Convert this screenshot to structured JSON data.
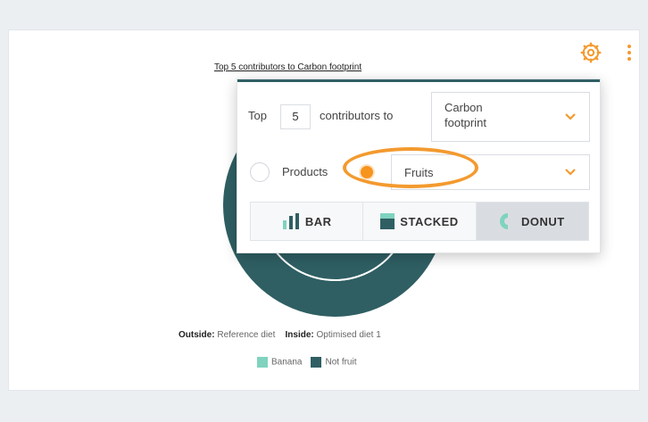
{
  "chart_card": {
    "title": "Top 5 contributors to Carbon footprint",
    "legend": {
      "outside_label": "Outside:",
      "outside_value": "Reference diet",
      "inside_label": "Inside:",
      "inside_value": "Optimised diet 1",
      "items": [
        {
          "label": "Banana",
          "color": "#7fd3bf"
        },
        {
          "label": "Not fruit",
          "color": "#2f5f63"
        }
      ]
    }
  },
  "chart_data": {
    "type": "pie",
    "title": "Top 5 contributors to Carbon footprint",
    "series": [
      {
        "name": "Reference diet",
        "ring": "outside",
        "categories": [
          "Banana",
          "Not fruit"
        ],
        "values": [
          0,
          100
        ]
      },
      {
        "name": "Optimised diet 1",
        "ring": "inside",
        "categories": [
          "Banana",
          "Not fruit"
        ],
        "values": [
          0,
          100
        ]
      }
    ],
    "legend_position": "bottom"
  },
  "settings_panel": {
    "top_label": "Top",
    "top_count": "5",
    "contributors_label": "contributors to",
    "metric_select": {
      "value": "Carbon\nfootprint"
    },
    "products_label": "Products",
    "category_select": {
      "value": "Fruits"
    },
    "chart_types": [
      {
        "label": "BAR",
        "active": false
      },
      {
        "label": "STACKED",
        "active": false
      },
      {
        "label": "DONUT",
        "active": true
      }
    ]
  },
  "icons": {
    "settings": "gear-icon",
    "more": "kebab-menu-icon",
    "chevron": "chevron-down-icon"
  },
  "colors": {
    "accent_orange": "#f39a2f",
    "dark_teal": "#2f5f63",
    "light_teal": "#7fd3bf"
  }
}
